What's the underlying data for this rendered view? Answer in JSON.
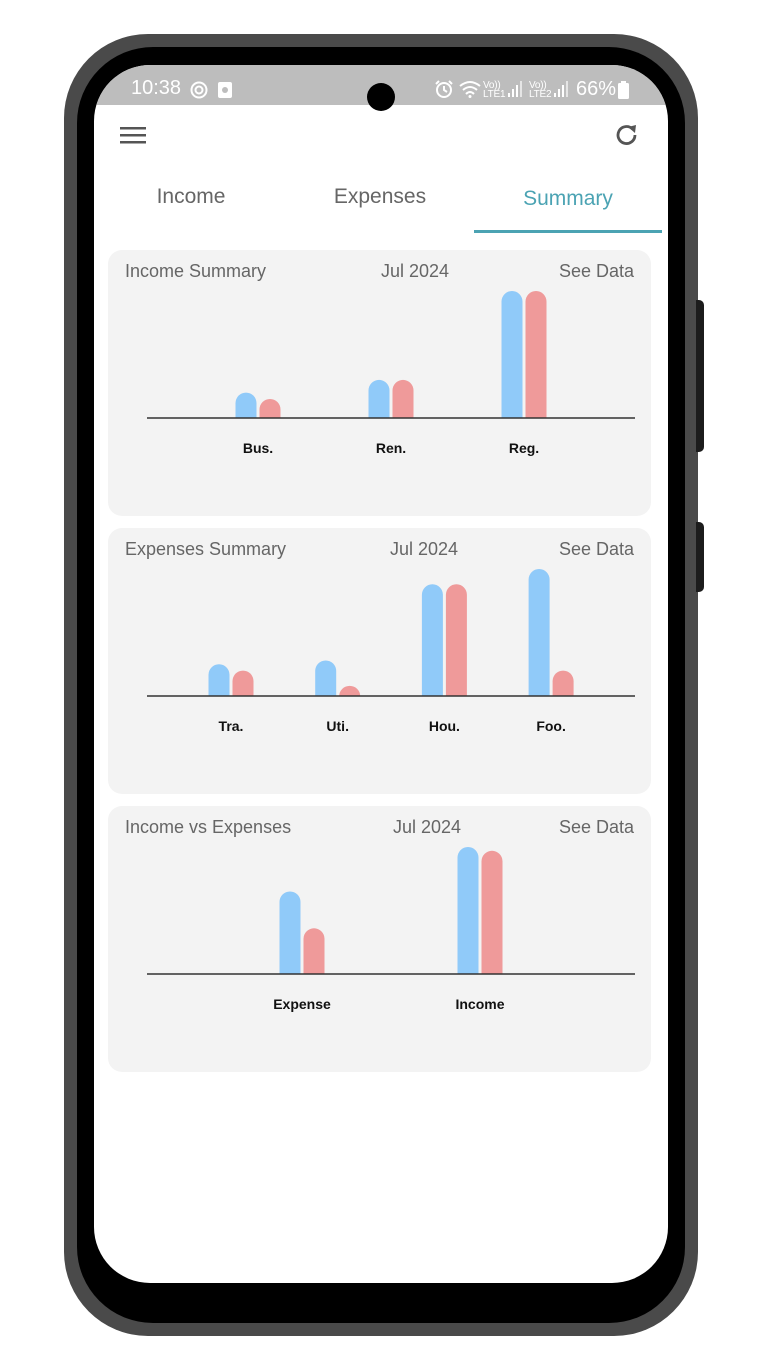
{
  "status_bar": {
    "time": "10:38",
    "battery": "66%",
    "sim1": [
      "Vo))",
      "LTE1"
    ],
    "sim2": [
      "Vo))",
      "LTE2"
    ]
  },
  "toolbar": {
    "menu_icon": "hamburger-menu-icon",
    "refresh_icon": "refresh-icon"
  },
  "tabs": [
    {
      "label": "Income",
      "active": false
    },
    {
      "label": "Expenses",
      "active": false
    },
    {
      "label": "Summary",
      "active": true
    }
  ],
  "colors": {
    "accent": "#4ba3b3",
    "series_blue": "#90caf9",
    "series_red": "#ef9a9a",
    "card_bg": "#f3f3f3"
  },
  "cards": [
    {
      "title": "Income Summary",
      "month": "Jul 2024",
      "link": "See Data"
    },
    {
      "title": "Expenses Summary",
      "month": "Jul 2024",
      "link": "See Data"
    },
    {
      "title": "Income vs Expenses",
      "month": "Jul 2024",
      "link": "See Data"
    }
  ],
  "chart_data": [
    {
      "type": "bar",
      "categories": [
        "Bus.",
        "Ren.",
        "Reg."
      ],
      "series": [
        {
          "values": [
            20,
            30,
            100
          ]
        },
        {
          "values": [
            15,
            30,
            100
          ]
        }
      ],
      "ylim": [
        0,
        100
      ],
      "grid": false
    },
    {
      "type": "bar",
      "categories": [
        "Tra.",
        "Uti.",
        "Hou.",
        "Foo."
      ],
      "series": [
        {
          "values": [
            25,
            28,
            88,
            100
          ]
        },
        {
          "values": [
            20,
            8,
            88,
            20
          ]
        }
      ],
      "ylim": [
        0,
        100
      ],
      "grid": false
    },
    {
      "type": "bar",
      "categories": [
        "Expense",
        "Income"
      ],
      "series": [
        {
          "values": [
            65,
            100
          ]
        },
        {
          "values": [
            36,
            97
          ]
        }
      ],
      "ylim": [
        0,
        100
      ],
      "grid": false
    }
  ]
}
